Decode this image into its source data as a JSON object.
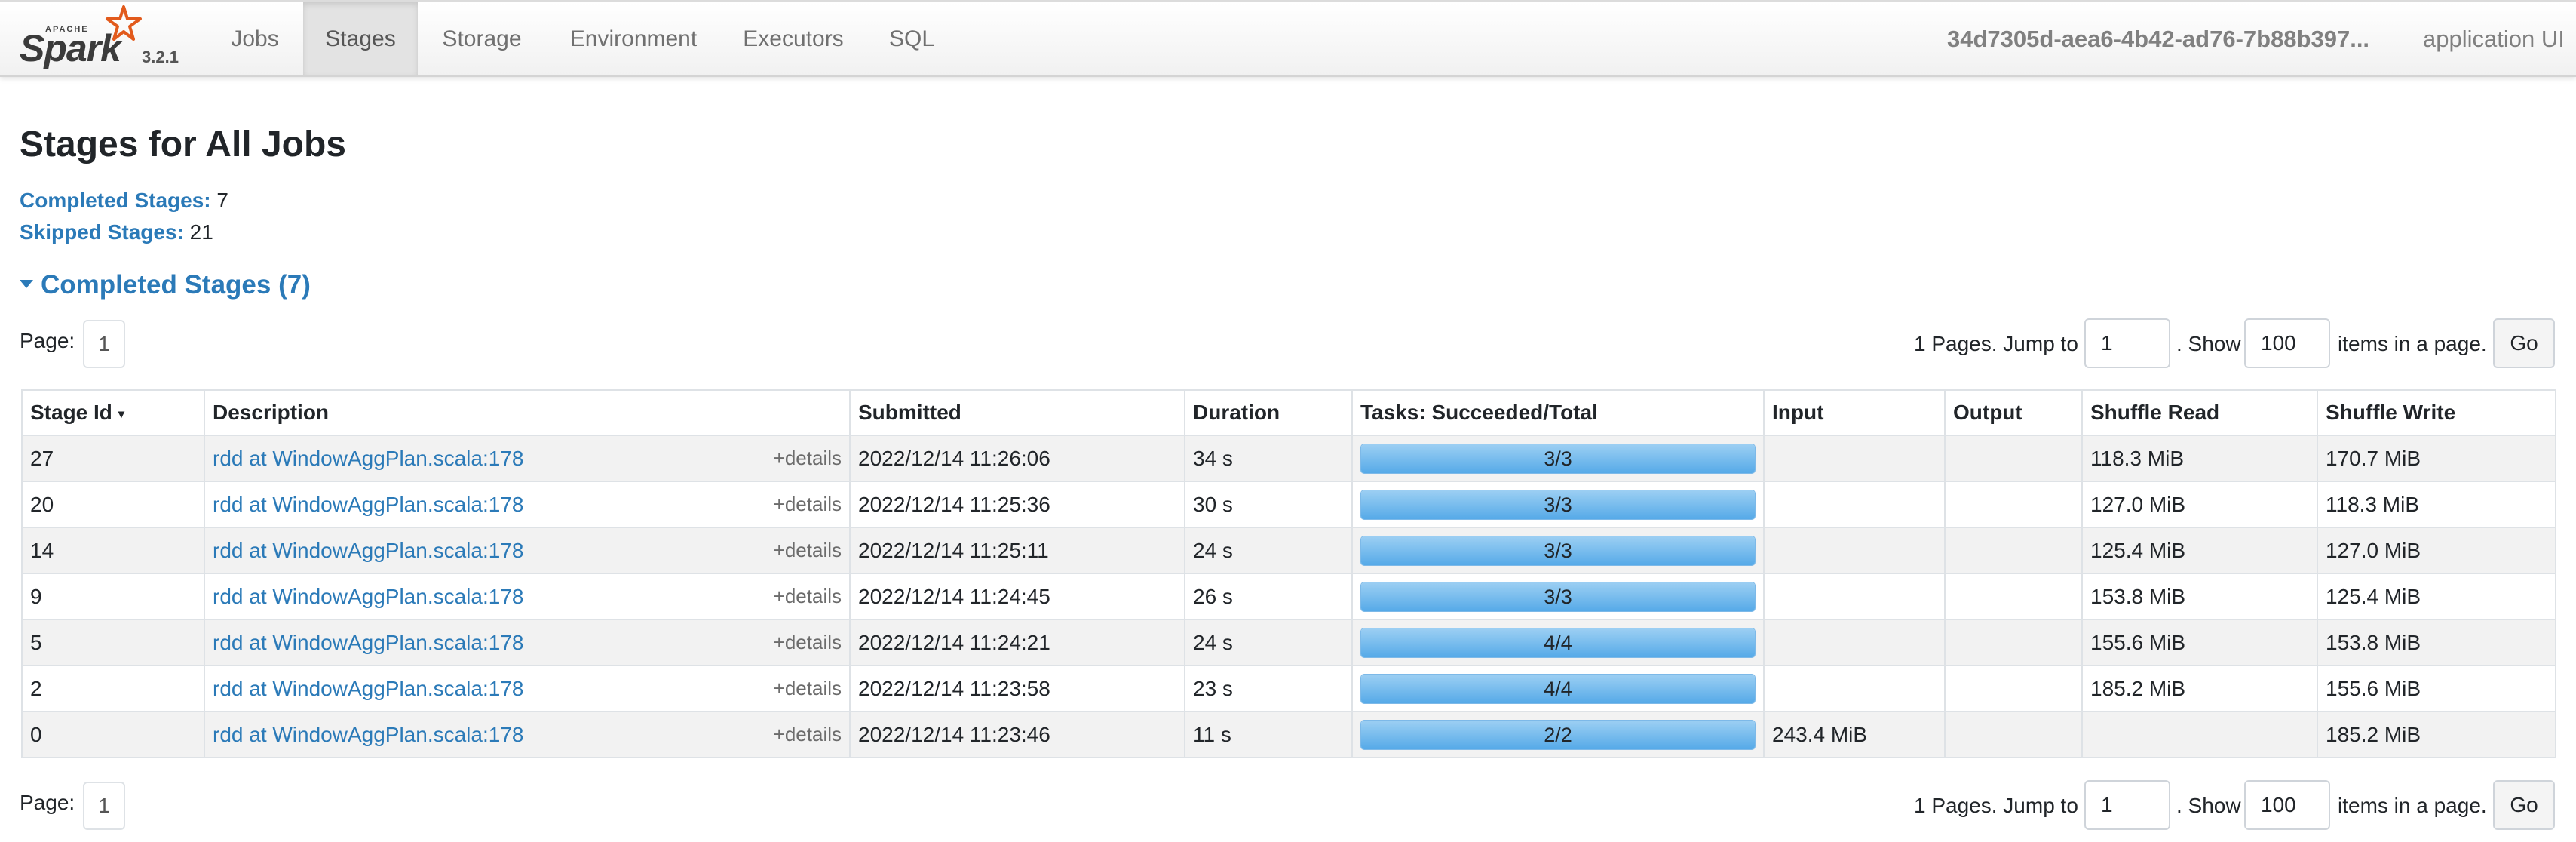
{
  "brand": {
    "apache": "APACHE",
    "name": "Spark",
    "version": "3.2.1"
  },
  "nav": {
    "tabs": [
      {
        "label": "Jobs",
        "active": false
      },
      {
        "label": "Stages",
        "active": true
      },
      {
        "label": "Storage",
        "active": false
      },
      {
        "label": "Environment",
        "active": false
      },
      {
        "label": "Executors",
        "active": false
      },
      {
        "label": "SQL",
        "active": false
      }
    ],
    "app_id": "34d7305d-aea6-4b42-ad76-7b88b397...",
    "app_suffix": "application UI"
  },
  "page": {
    "title": "Stages for All Jobs",
    "completed_label": "Completed Stages:",
    "completed_value": "7",
    "skipped_label": "Skipped Stages:",
    "skipped_value": "21",
    "section_title": "Completed Stages (7)"
  },
  "pagination": {
    "page_label": "Page:",
    "current_page": "1",
    "pages_text": "1 Pages. Jump to",
    "jump_value": "1",
    "show_text": ". Show",
    "show_value": "100",
    "items_text": "items in a page.",
    "go_label": "Go"
  },
  "table": {
    "headers": [
      "Stage Id",
      "Description",
      "Submitted",
      "Duration",
      "Tasks: Succeeded/Total",
      "Input",
      "Output",
      "Shuffle Read",
      "Shuffle Write"
    ],
    "sort_indicator": "▾",
    "details_label": "+details",
    "rows": [
      {
        "id": "27",
        "desc": "rdd at WindowAggPlan.scala:178",
        "submitted": "2022/12/14 11:26:06",
        "duration": "34 s",
        "tasks": "3/3",
        "progress": 1.0,
        "input": "",
        "output": "",
        "shuffle_read": "118.3 MiB",
        "shuffle_write": "170.7 MiB"
      },
      {
        "id": "20",
        "desc": "rdd at WindowAggPlan.scala:178",
        "submitted": "2022/12/14 11:25:36",
        "duration": "30 s",
        "tasks": "3/3",
        "progress": 1.0,
        "input": "",
        "output": "",
        "shuffle_read": "127.0 MiB",
        "shuffle_write": "118.3 MiB"
      },
      {
        "id": "14",
        "desc": "rdd at WindowAggPlan.scala:178",
        "submitted": "2022/12/14 11:25:11",
        "duration": "24 s",
        "tasks": "3/3",
        "progress": 1.0,
        "input": "",
        "output": "",
        "shuffle_read": "125.4 MiB",
        "shuffle_write": "127.0 MiB"
      },
      {
        "id": "9",
        "desc": "rdd at WindowAggPlan.scala:178",
        "submitted": "2022/12/14 11:24:45",
        "duration": "26 s",
        "tasks": "3/3",
        "progress": 1.0,
        "input": "",
        "output": "",
        "shuffle_read": "153.8 MiB",
        "shuffle_write": "125.4 MiB"
      },
      {
        "id": "5",
        "desc": "rdd at WindowAggPlan.scala:178",
        "submitted": "2022/12/14 11:24:21",
        "duration": "24 s",
        "tasks": "4/4",
        "progress": 1.0,
        "input": "",
        "output": "",
        "shuffle_read": "155.6 MiB",
        "shuffle_write": "153.8 MiB"
      },
      {
        "id": "2",
        "desc": "rdd at WindowAggPlan.scala:178",
        "submitted": "2022/12/14 11:23:58",
        "duration": "23 s",
        "tasks": "4/4",
        "progress": 1.0,
        "input": "",
        "output": "",
        "shuffle_read": "185.2 MiB",
        "shuffle_write": "155.6 MiB"
      },
      {
        "id": "0",
        "desc": "rdd at WindowAggPlan.scala:178",
        "submitted": "2022/12/14 11:23:46",
        "duration": "11 s",
        "tasks": "2/2",
        "progress": 1.0,
        "input": "243.4 MiB",
        "output": "",
        "shuffle_read": "",
        "shuffle_write": "185.2 MiB"
      }
    ]
  },
  "colors": {
    "link": "#2b7ab8",
    "progress": "#56aae8",
    "row_stripe": "#f2f2f2"
  }
}
